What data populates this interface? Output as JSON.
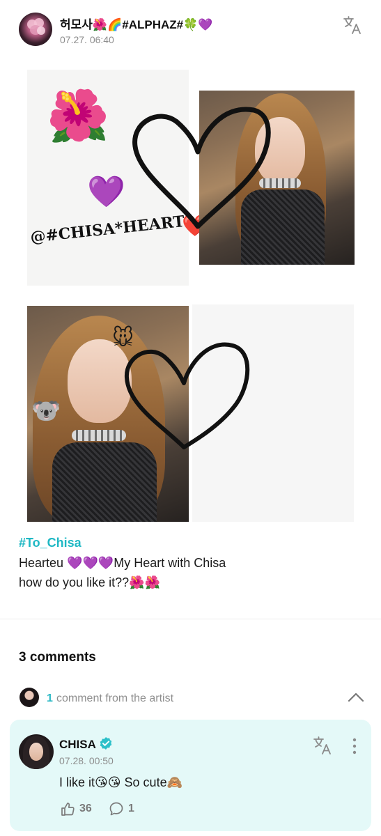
{
  "post": {
    "author": "허모사🌺🌈#ALPHAZ#🍀💜",
    "time": "07.27. 06:40",
    "translate_icon": "translate-icon",
    "collage": {
      "caption_tag": "@#CHISA*HEART",
      "caption_emoji": "❤️#",
      "flower_emoji": "🌺",
      "purple_heart_emoji": "💜",
      "koala_emoji": "🐨",
      "mouse_emoji": "🐭"
    },
    "hashtag": "#To_Chisa",
    "body_line1": "Hearteu 💜💜💜My Heart with Chisa",
    "body_line2": "how do you like it??🌺🌺"
  },
  "comments": {
    "count_label": "3 comments",
    "artist_count": "1",
    "artist_label": "comment from the artist",
    "collapse_icon": "chevron-up-icon",
    "items": [
      {
        "author": "CHISA",
        "time": "07.28. 00:50",
        "text": "I like it😘😘 So cute🙈",
        "likes": "36",
        "replies": "1"
      }
    ]
  },
  "colors": {
    "accent": "#1fb8c4",
    "comment_bg": "#e4f9f8",
    "muted": "#8d8d8d"
  }
}
